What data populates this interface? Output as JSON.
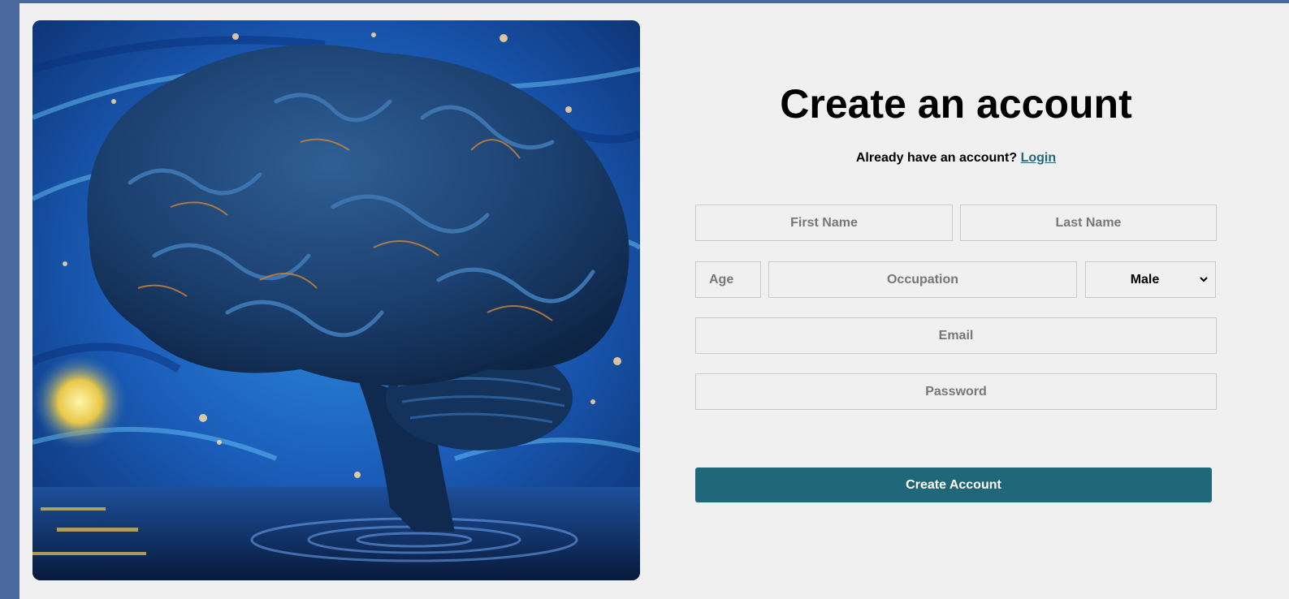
{
  "form": {
    "title": "Create an account",
    "login_prompt": "Already have an account?",
    "login_link": "Login",
    "first_name_placeholder": "First Name",
    "last_name_placeholder": "Last Name",
    "age_placeholder": "Age",
    "occupation_placeholder": "Occupation",
    "gender_selected": "Male",
    "email_placeholder": "Email",
    "password_placeholder": "Password",
    "submit_label": "Create Account"
  },
  "colors": {
    "accent": "#21677a",
    "page_background": "#4a6a9e",
    "card_background": "#f0f0f0"
  },
  "icons": {
    "select_arrow": "chevron-down-icon"
  }
}
